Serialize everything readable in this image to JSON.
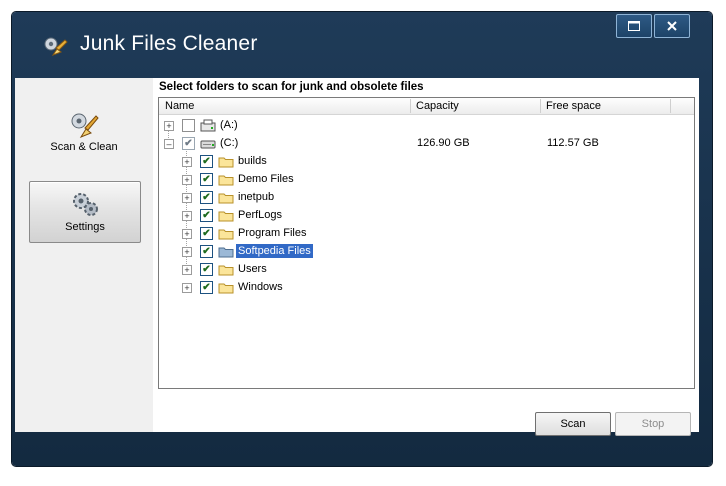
{
  "window": {
    "title": "Junk Files Cleaner",
    "maximize_glyph": "□",
    "close_glyph": "✕"
  },
  "sidebar": {
    "items": [
      {
        "label": "Scan & Clean",
        "icon": "broom-icon"
      },
      {
        "label": "Settings",
        "icon": "gears-icon"
      }
    ]
  },
  "main": {
    "heading": "Select folders to scan for junk and obsolete files",
    "columns": {
      "name": "Name",
      "capacity": "Capacity",
      "free_space": "Free space"
    },
    "tree": [
      {
        "label": "(A:)",
        "checked": false,
        "capacity": "",
        "free": "",
        "icon": "floppy-drive-icon"
      },
      {
        "label": "(C:)",
        "checked": "partial",
        "capacity": "126.90 GB",
        "free": "112.57 GB",
        "icon": "hard-drive-icon"
      },
      {
        "label": "builds",
        "checked": true,
        "icon": "folder-icon"
      },
      {
        "label": "Demo Files",
        "checked": true,
        "icon": "folder-icon"
      },
      {
        "label": "inetpub",
        "checked": true,
        "icon": "folder-icon"
      },
      {
        "label": "PerfLogs",
        "checked": true,
        "icon": "folder-icon"
      },
      {
        "label": "Program Files",
        "checked": true,
        "icon": "folder-icon"
      },
      {
        "label": "Softpedia Files",
        "checked": true,
        "selected": true,
        "icon": "folder-icon"
      },
      {
        "label": "Users",
        "checked": true,
        "icon": "folder-icon"
      },
      {
        "label": "Windows",
        "checked": true,
        "icon": "folder-icon"
      }
    ],
    "expander": "+",
    "check_mark": "✔"
  },
  "footer": {
    "scan_label": "Scan",
    "stop_label": "Stop"
  },
  "colors": {
    "frame": "#1f3b58",
    "selection": "#3169c6"
  }
}
